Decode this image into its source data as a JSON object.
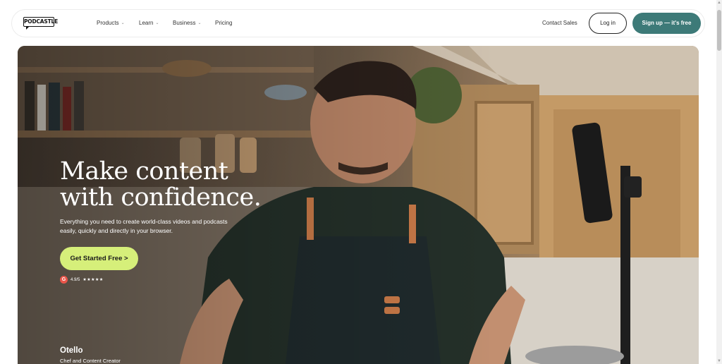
{
  "nav": {
    "logo": "PODCASTLE",
    "items": [
      {
        "label": "Products",
        "has_dropdown": true
      },
      {
        "label": "Learn",
        "has_dropdown": true
      },
      {
        "label": "Business",
        "has_dropdown": true
      },
      {
        "label": "Pricing",
        "has_dropdown": false
      }
    ],
    "contact": "Contact Sales",
    "login": "Log in",
    "signup": "Sign up — it's free"
  },
  "hero": {
    "headline_line1": "Make content",
    "headline_line2": "with confidence.",
    "subtitle": "Everything you need to create world-class videos and podcasts easily, quickly and directly in your browser.",
    "cta": "Get Started Free >",
    "rating_source_icon": "g2-icon",
    "rating": "4.9/5",
    "stars": "★★★★★",
    "person_name": "Otello",
    "person_role": "Chef and Content Creator"
  },
  "colors": {
    "signup_bg": "#3d7a78",
    "cta_bg": "#d6ef7a",
    "rating_icon": "#e9554a"
  }
}
